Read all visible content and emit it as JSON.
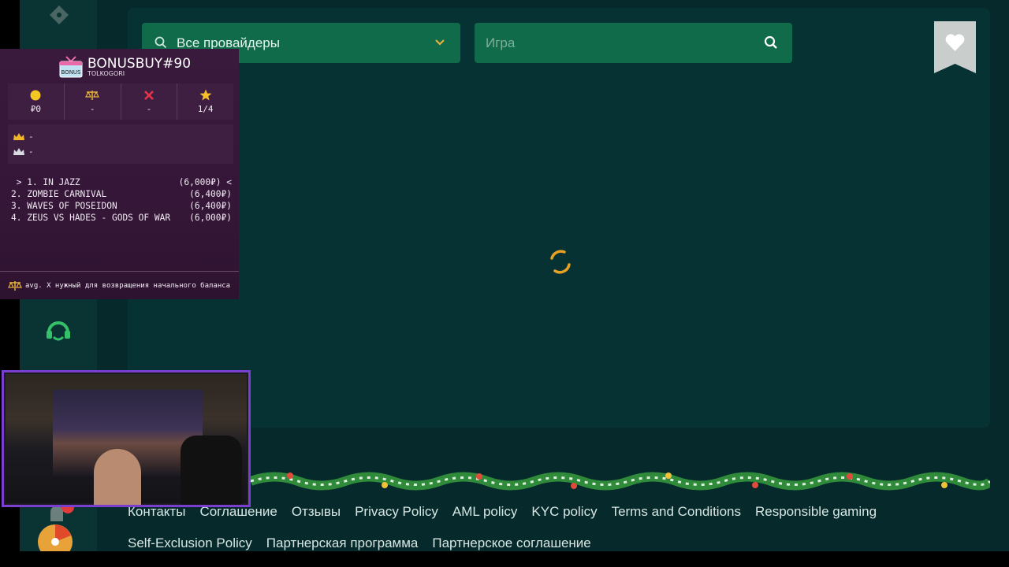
{
  "provider_select": {
    "label": "Все провайдеры"
  },
  "game_search": {
    "placeholder": "Игра"
  },
  "footer": {
    "row1": [
      "Контакты",
      "Соглашение",
      "Отзывы",
      "Privacy Policy",
      "AML policy",
      "KYC policy",
      "Terms and Conditions",
      "Responsible gaming"
    ],
    "row2": [
      "Self-Exclusion Policy",
      "Партнерская программа",
      "Партнерское соглашение"
    ]
  },
  "bonus_buy": {
    "title": "BONUSBUY#90",
    "subtitle": "TOLKOGORI",
    "logo_text": "BONUS",
    "stats": [
      {
        "icon": "coin-icon",
        "value": "₽0"
      },
      {
        "icon": "scales-icon",
        "value": "-"
      },
      {
        "icon": "cross-icon",
        "value": "-"
      },
      {
        "icon": "star-icon",
        "value": "1/4"
      }
    ],
    "best": [
      "-",
      "-"
    ],
    "list": [
      {
        "text": " > 1. IN JAZZ",
        "amount": "(6,000₽) <"
      },
      {
        "text": "2. ZOMBIE CARNIVAL",
        "amount": "(6,400₽)"
      },
      {
        "text": "3. WAVES OF POSEIDON",
        "amount": "(6,400₽)"
      },
      {
        "text": "4. ZEUS VS HADES - GODS OF WAR",
        "amount": "(6,000₽)"
      }
    ],
    "footer_note": "avg. X нужный для возвращения начального баланса"
  },
  "colors": {
    "accent_green": "#0f6b4a",
    "background": "#062a2b",
    "overlay_purple": "#3a1a3c",
    "spinner_orange": "#f0a020"
  }
}
